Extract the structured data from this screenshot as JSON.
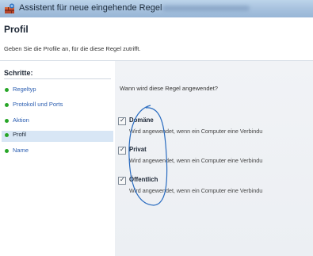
{
  "window": {
    "title": "Assistent für neue eingehende Regel"
  },
  "header": {
    "title": "Profil",
    "subtitle": "Geben Sie die Profile an, für die diese Regel zutrifft."
  },
  "sidebar": {
    "heading": "Schritte:",
    "items": [
      {
        "label": "Regeltyp"
      },
      {
        "label": "Protokoll und Ports"
      },
      {
        "label": "Aktion"
      },
      {
        "label": "Profil",
        "active": true
      },
      {
        "label": "Name"
      }
    ]
  },
  "main": {
    "question": "Wann wird diese Regel angewendet?",
    "options": [
      {
        "label": "Domäne",
        "description": "Wird angewendet, wenn ein Computer eine Verbindu",
        "checked": true
      },
      {
        "label": "Privat",
        "description": "Wird angewendet, wenn ein Computer eine Verbindu",
        "checked": true
      },
      {
        "label": "Öffentlich",
        "description": "Wird angewendet, wenn ein Computer eine Verbindu",
        "checked": true
      }
    ]
  },
  "colors": {
    "titlebar": "#a9c3df",
    "step_link": "#2a5db0",
    "step_dot": "#27a627",
    "active_step_bg": "#d8e6f5",
    "annotation_circle": "#2a6cc0"
  },
  "icons": {
    "app": "firewall-icon",
    "check": "checkmark-icon"
  }
}
